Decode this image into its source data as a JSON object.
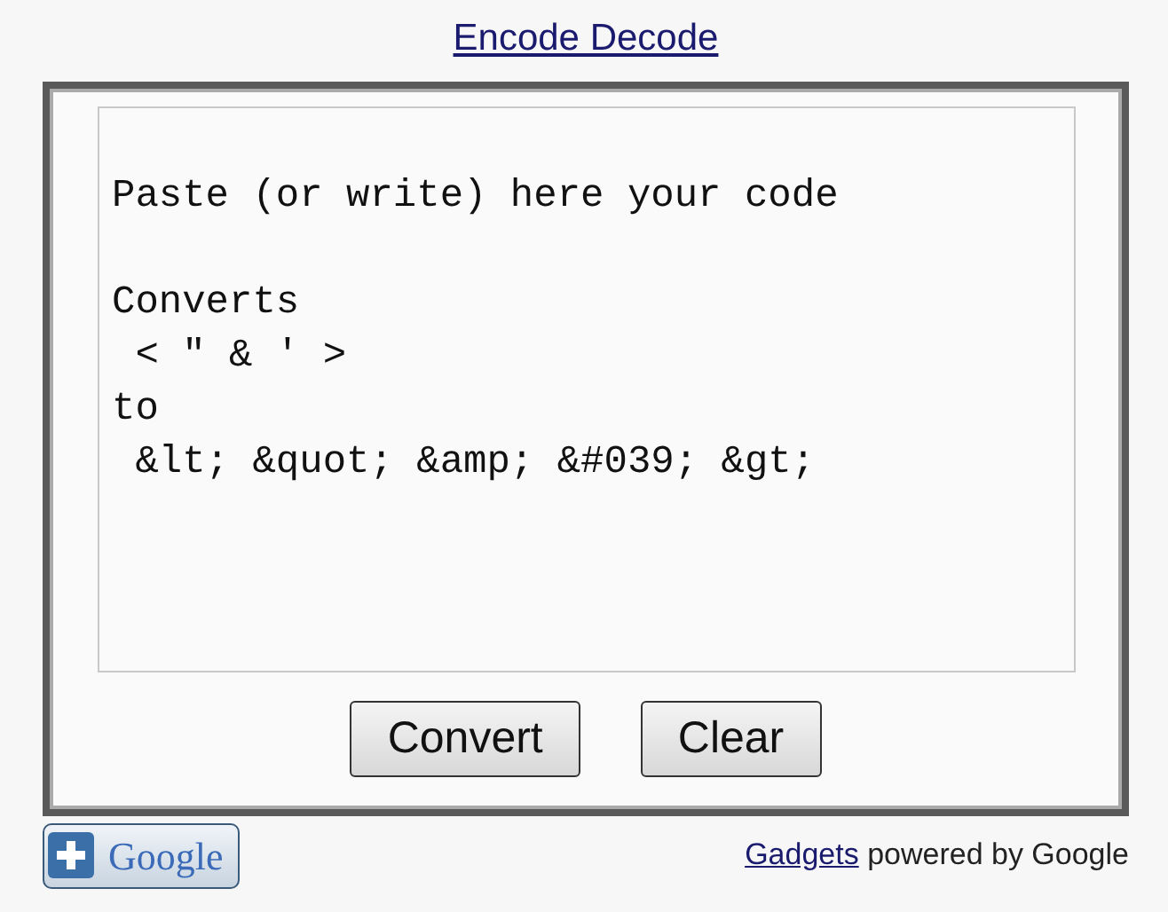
{
  "title": "Encode Decode",
  "editor": {
    "value": "\nPaste (or write) here your code\n\nConverts\n < \" & ' >\nto\n &lt; &quot; &amp; &#039; &gt;"
  },
  "buttons": [
    "Convert",
    "Clear"
  ],
  "footer": {
    "add_button": "Google",
    "link": "Gadgets",
    "text": "powered by Google"
  }
}
